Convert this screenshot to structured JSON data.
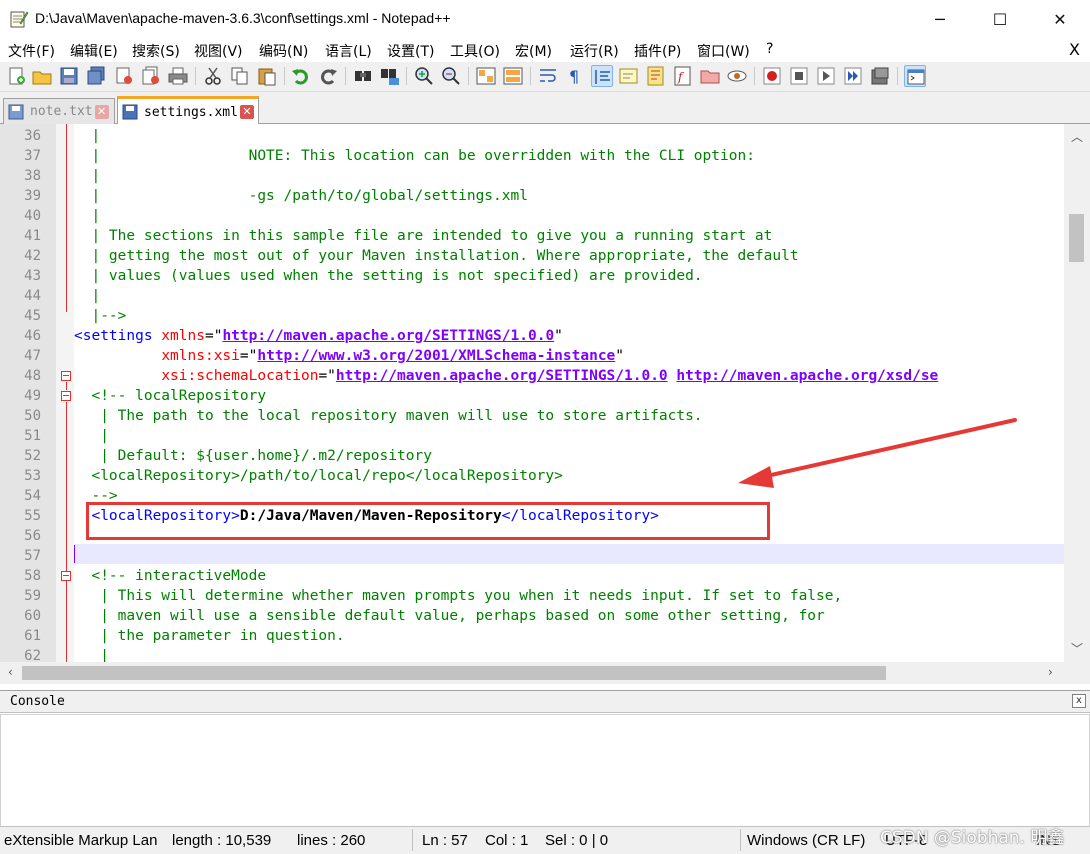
{
  "window": {
    "title": "D:\\Java\\Maven\\apache-maven-3.6.3\\conf\\settings.xml - Notepad++",
    "minimize": "─",
    "maximize": "☐",
    "close": "✕"
  },
  "menu": {
    "items": [
      "文件(F)",
      "编辑(E)",
      "搜索(S)",
      "视图(V)",
      "编码(N)",
      "语言(L)",
      "设置(T)",
      "工具(O)",
      "宏(M)",
      "运行(R)",
      "插件(P)",
      "窗口(W)",
      "?"
    ],
    "close": "X"
  },
  "tabs": [
    {
      "label": "note.txt",
      "active": false
    },
    {
      "label": "settings.xml",
      "active": true
    }
  ],
  "editor": {
    "line_numbers": [
      "36",
      "37",
      "38",
      "39",
      "40",
      "41",
      "42",
      "43",
      "44",
      "45",
      "46",
      "47",
      "48",
      "49",
      "50",
      "51",
      "52",
      "53",
      "54",
      "55",
      "56",
      "57",
      "58",
      "59",
      "60",
      "61",
      "62"
    ],
    "lines": {
      "l36": "  |",
      "l37": "  |                 NOTE: This location can be overridden with the CLI option:",
      "l38": "  |",
      "l39": "  |                 -gs /path/to/global/settings.xml",
      "l40": "  |",
      "l41": "  | The sections in this sample file are intended to give you a running start at",
      "l42": "  | getting the most out of your Maven installation. Where appropriate, the default",
      "l43": "  | values (values used when the setting is not specified) are provided.",
      "l44": "  |",
      "l45": "  |-->",
      "l46_tag": "<settings",
      "l46_attr": " xmlns",
      "l46_eq": "=\"",
      "l46_val": "http://maven.apache.org/SETTINGS/1.0.0",
      "l46_end": "\"",
      "l47_pad": "          ",
      "l47_attr": "xmlns:xsi",
      "l47_eq": "=\"",
      "l47_val": "http://www.w3.org/2001/XMLSchema-instance",
      "l47_end": "\"",
      "l48_pad": "          ",
      "l48_attr": "xsi:schemaLocation",
      "l48_eq": "=\"",
      "l48_val1": "http://maven.apache.org/SETTINGS/1.0.0",
      "l48_sp": " ",
      "l48_val2": "http://maven.apache.org/xsd/se",
      "l49": "  <!-- localRepository",
      "l50": "   | The path to the local repository maven will use to store artifacts.",
      "l51": "   |",
      "l52": "   | Default: ${user.home}/.m2/repository",
      "l53": "  <localRepository>/path/to/local/repo</localRepository>",
      "l54": "  -->",
      "l55_open": "  <localRepository>",
      "l55_val": "D:/Java/Maven/Maven-Repository",
      "l55_close": "</localRepository>",
      "l58": "  <!-- interactiveMode",
      "l59": "   | This will determine whether maven prompts you when it needs input. If set to false,",
      "l60": "   | maven will use a sensible default value, perhaps based on some other setting, for",
      "l61": "   | the parameter in question.",
      "l62": "   |"
    }
  },
  "console": {
    "title": "Console",
    "close": "x"
  },
  "statusbar": {
    "lang": "eXtensible Markup Lan",
    "length": "length : 10,539",
    "lines": "lines : 260",
    "ln": "Ln : 57",
    "col": "Col : 1",
    "sel": "Sel : 0 | 0",
    "eol": "Windows (CR LF)",
    "encoding": "UTF-8",
    "mode": "INS",
    "watermark": "CSDN @Siobhan. 明鑫"
  },
  "colors": {
    "comment": "#008000",
    "tag": "#0000ff",
    "attribute": "#ff0000",
    "string": "#8000ff",
    "highlight_box": "#e53935",
    "current_line": "#e8e8ff"
  },
  "icons": [
    "new-file-icon",
    "open-file-icon",
    "save-icon",
    "save-all-icon",
    "close-icon",
    "close-all-icon",
    "print-icon",
    "cut-icon",
    "copy-icon",
    "paste-icon",
    "undo-icon",
    "redo-icon",
    "find-icon",
    "replace-icon",
    "zoom-in-icon",
    "zoom-out-icon",
    "sync-v-icon",
    "sync-h-icon",
    "word-wrap-icon",
    "show-all-chars-icon",
    "indent-guide-icon",
    "udl-icon",
    "doc-map-icon",
    "function-list-icon",
    "folder-workspace-icon",
    "monitoring-icon",
    "record-macro-icon",
    "stop-record-icon",
    "play-macro-icon",
    "run-macro-multi-icon",
    "save-macro-icon",
    "console-icon"
  ]
}
